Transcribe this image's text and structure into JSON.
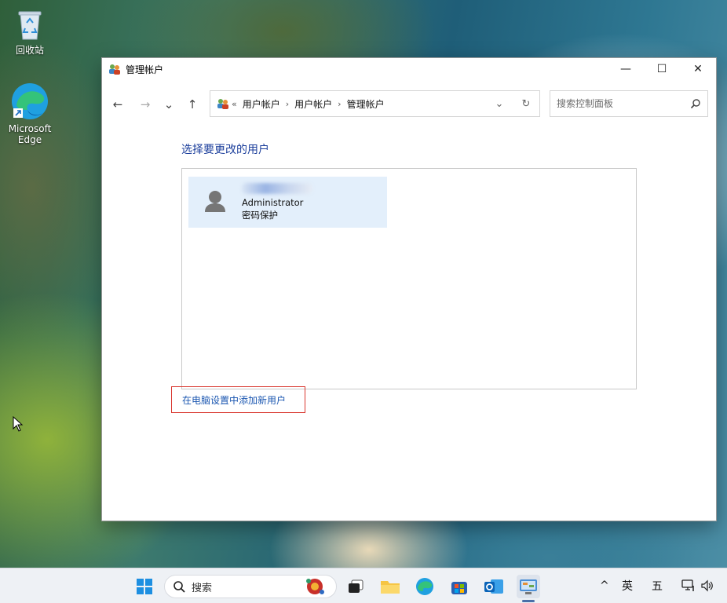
{
  "desktop": {
    "icons": [
      {
        "label": "回收站"
      },
      {
        "label": "Microsoft Edge"
      }
    ]
  },
  "window": {
    "title": "管理帐户",
    "controls": {
      "minimize": "—",
      "maximize": "☐",
      "close": "✕"
    }
  },
  "nav": {
    "back": "←",
    "forward": "→",
    "recent": "⌄",
    "up": "↑",
    "overflow": "«",
    "breadcrumbs": [
      "用户帐户",
      "用户帐户",
      "管理帐户"
    ],
    "separator": "›",
    "dropdown": "⌄",
    "refresh": "↻"
  },
  "search": {
    "placeholder": "搜索控制面板"
  },
  "content": {
    "heading": "选择要更改的用户",
    "users": [
      {
        "name": "Administrator",
        "status": "密码保护"
      }
    ],
    "add_user_link": "在电脑设置中添加新用户"
  },
  "taskbar": {
    "search_label": "搜索",
    "tray": {
      "chevron": "^",
      "ime_lang": "英",
      "ime_mode": "五"
    }
  }
}
